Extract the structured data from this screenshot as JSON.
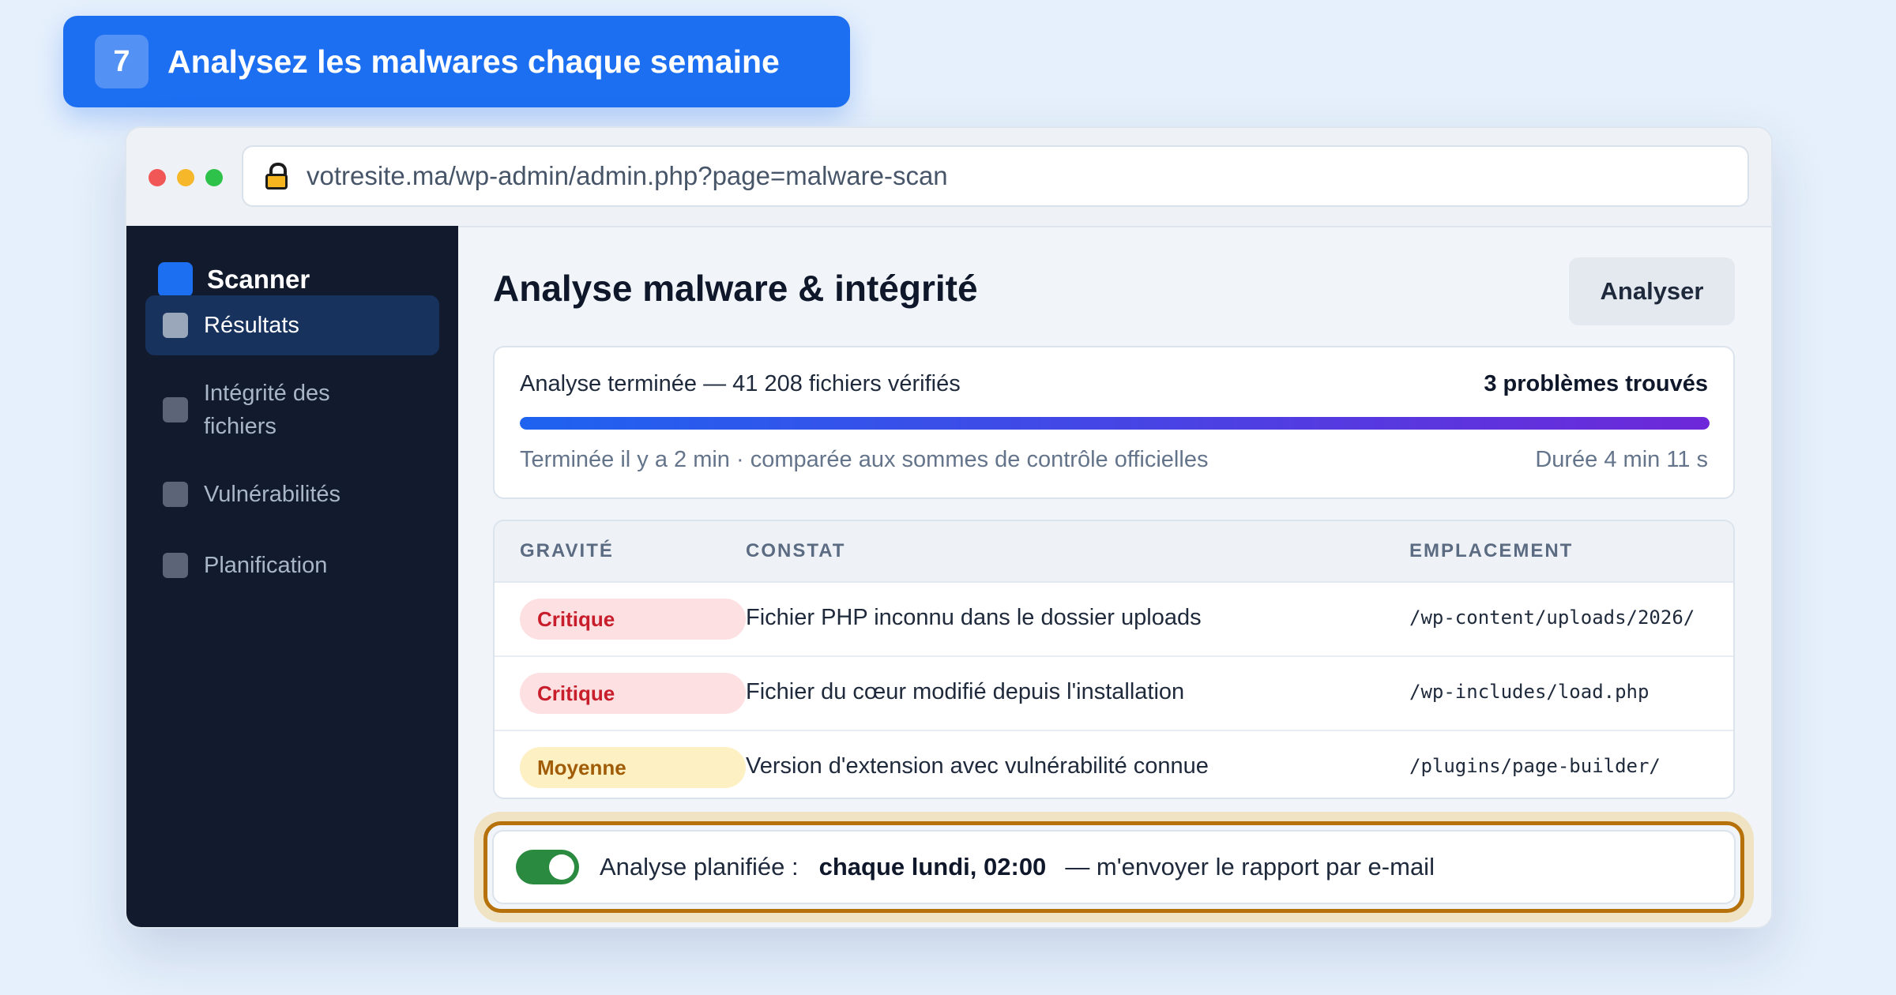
{
  "banner": {
    "step": "7",
    "title": "Analysez les malwares chaque semaine"
  },
  "browser": {
    "url": "votresite.ma/wp-admin/admin.php?page=malware-scan"
  },
  "sidebar": {
    "brand": "Scanner",
    "items": [
      {
        "label": "Résultats",
        "active": true
      },
      {
        "label": "Intégrité des fichiers",
        "active": false
      },
      {
        "label": "Vulnérabilités",
        "active": false
      },
      {
        "label": "Planification",
        "active": false
      }
    ]
  },
  "main": {
    "title": "Analyse malware & intégrité",
    "analyze_button": "Analyser",
    "summary": {
      "status": "Analyse terminée — 41 208 fichiers vérifiés",
      "issues": "3 problèmes trouvés",
      "progress_percent": 100,
      "meta": "Terminée il y a 2 min · comparée aux sommes de contrôle officielles",
      "duration": "Durée 4 min 11 s"
    },
    "table": {
      "columns": [
        "GRAVITÉ",
        "CONSTAT",
        "EMPLACEMENT"
      ],
      "rows": [
        {
          "severity": "Critique",
          "finding": "Fichier PHP inconnu dans le dossier uploads",
          "location": "/wp-content/uploads/2026/"
        },
        {
          "severity": "Critique",
          "finding": "Fichier du cœur modifié depuis l'installation",
          "location": "/wp-includes/load.php"
        },
        {
          "severity": "Moyenne",
          "finding": "Version d'extension avec vulnérabilité connue",
          "location": "/plugins/page-builder/"
        }
      ]
    },
    "schedule": {
      "enabled": true,
      "label": "Analyse planifiée :",
      "value": "chaque lundi, 02:00",
      "note": "— m'envoyer le rapport par e-mail"
    }
  },
  "colors": {
    "accent": "#1d6ff2",
    "sidebar_bg": "#121b2e",
    "critical": "#c81d2b",
    "medium": "#a15c07",
    "toggle_on": "#2a8a3f",
    "highlight": "#b7710a"
  }
}
